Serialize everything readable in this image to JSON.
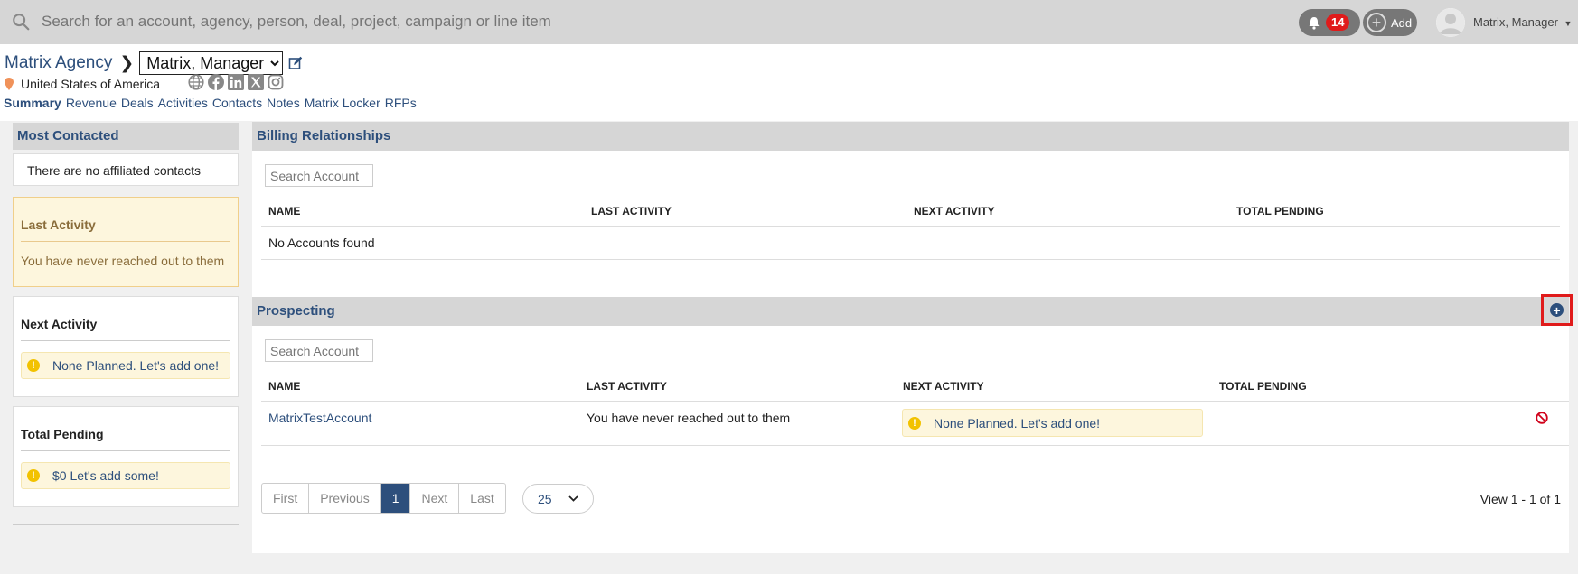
{
  "topbar": {
    "search_placeholder": "Search for an account, agency, person, deal, project, campaign or line item",
    "notification_count": "14",
    "add_label": "Add",
    "user_name": "Matrix, Manager"
  },
  "header": {
    "agency_name": "Matrix Agency",
    "selected_contact": "Matrix, Manager",
    "location": "United States of America",
    "tabs": [
      "Summary",
      "Revenue",
      "Deals",
      "Activities",
      "Contacts",
      "Notes",
      "Matrix Locker",
      "RFPs"
    ]
  },
  "sidebar": {
    "most_contacted_title": "Most Contacted",
    "most_contacted_empty": "There are no affiliated contacts",
    "last_activity_title": "Last Activity",
    "last_activity_text": "You have never reached out to them",
    "next_activity_title": "Next Activity",
    "next_activity_text": "None Planned. Let's add one!",
    "total_pending_title": "Total Pending",
    "total_pending_text": "$0 Let's add some!"
  },
  "billing": {
    "title": "Billing Relationships",
    "search_placeholder": "Search Account",
    "columns": [
      "NAME",
      "LAST ACTIVITY",
      "NEXT ACTIVITY",
      "TOTAL PENDING"
    ],
    "empty_text": "No Accounts found"
  },
  "prospecting": {
    "title": "Prospecting",
    "search_placeholder": "Search Account",
    "columns": [
      "NAME",
      "LAST ACTIVITY",
      "NEXT ACTIVITY",
      "TOTAL PENDING"
    ],
    "rows": [
      {
        "name": "MatrixTestAccount",
        "last_activity": "You have never reached out to them",
        "next_activity": "None Planned. Let's add one!",
        "total_pending": ""
      }
    ]
  },
  "pagination": {
    "first": "First",
    "previous": "Previous",
    "current": "1",
    "next": "Next",
    "last": "Last",
    "page_size": "25",
    "view_text": "View 1 - 1 of 1"
  },
  "colors": {
    "accent": "#2d4f7c",
    "warning_bg": "#fdf6dd",
    "highlight_border": "#e01b1b"
  }
}
